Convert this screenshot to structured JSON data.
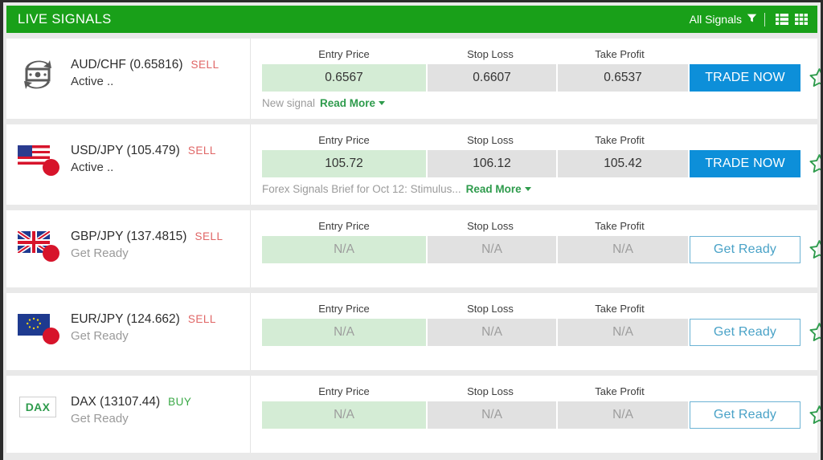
{
  "header": {
    "title": "LIVE SIGNALS",
    "filter_label": "All Signals",
    "filter_icon": "funnel-icon",
    "list_view_icon": "list-view-icon",
    "grid_view_icon": "grid-view-icon",
    "background_color": "#19a019"
  },
  "columns": {
    "entry": "Entry Price",
    "stop": "Stop Loss",
    "take": "Take Profit"
  },
  "colors": {
    "green_header": "#19a019",
    "entry_cell": "#d4ecd5",
    "value_cell": "#e1e1e1",
    "trade_button": "#0d8fd9",
    "ready_button_text": "#49a2c7",
    "sell": "#e06666",
    "buy": "#39a845",
    "read_more": "#2e9b4c",
    "star": "#2e9b4c"
  },
  "signals": [
    {
      "icon": "money-exchange-icon",
      "instrument": "AUD/CHF (0.65816)",
      "side": "SELL",
      "status": "Active ..",
      "entry": "0.6567",
      "stop": "0.6607",
      "take": "0.6537",
      "action": "TRADE NOW",
      "note_text": "New signal",
      "read_more": "Read More",
      "favorite_icon": "star-outline-icon"
    },
    {
      "icon": "usd-jpy-flag-icon",
      "instrument": "USD/JPY (105.479)",
      "side": "SELL",
      "status": "Active ..",
      "entry": "105.72",
      "stop": "106.12",
      "take": "105.42",
      "action": "TRADE NOW",
      "note_text": "Forex Signals Brief for Oct 12: Stimulus...",
      "read_more": "Read More",
      "favorite_icon": "star-outline-icon"
    },
    {
      "icon": "gbp-jpy-flag-icon",
      "instrument": "GBP/JPY (137.4815)",
      "side": "SELL",
      "status": "Get Ready",
      "entry": "N/A",
      "stop": "N/A",
      "take": "N/A",
      "action": "Get Ready",
      "note_text": "",
      "read_more": "",
      "favorite_icon": "star-outline-icon"
    },
    {
      "icon": "eur-jpy-flag-icon",
      "instrument": "EUR/JPY (124.662)",
      "side": "SELL",
      "status": "Get Ready",
      "entry": "N/A",
      "stop": "N/A",
      "take": "N/A",
      "action": "Get Ready",
      "note_text": "",
      "read_more": "",
      "favorite_icon": "star-outline-icon"
    },
    {
      "icon": "dax-badge-icon",
      "badge_label": "DAX",
      "instrument": "DAX (13107.44)",
      "side": "BUY",
      "status": "Get Ready",
      "entry": "N/A",
      "stop": "N/A",
      "take": "N/A",
      "action": "Get Ready",
      "note_text": "",
      "read_more": "",
      "favorite_icon": "star-outline-icon"
    }
  ]
}
